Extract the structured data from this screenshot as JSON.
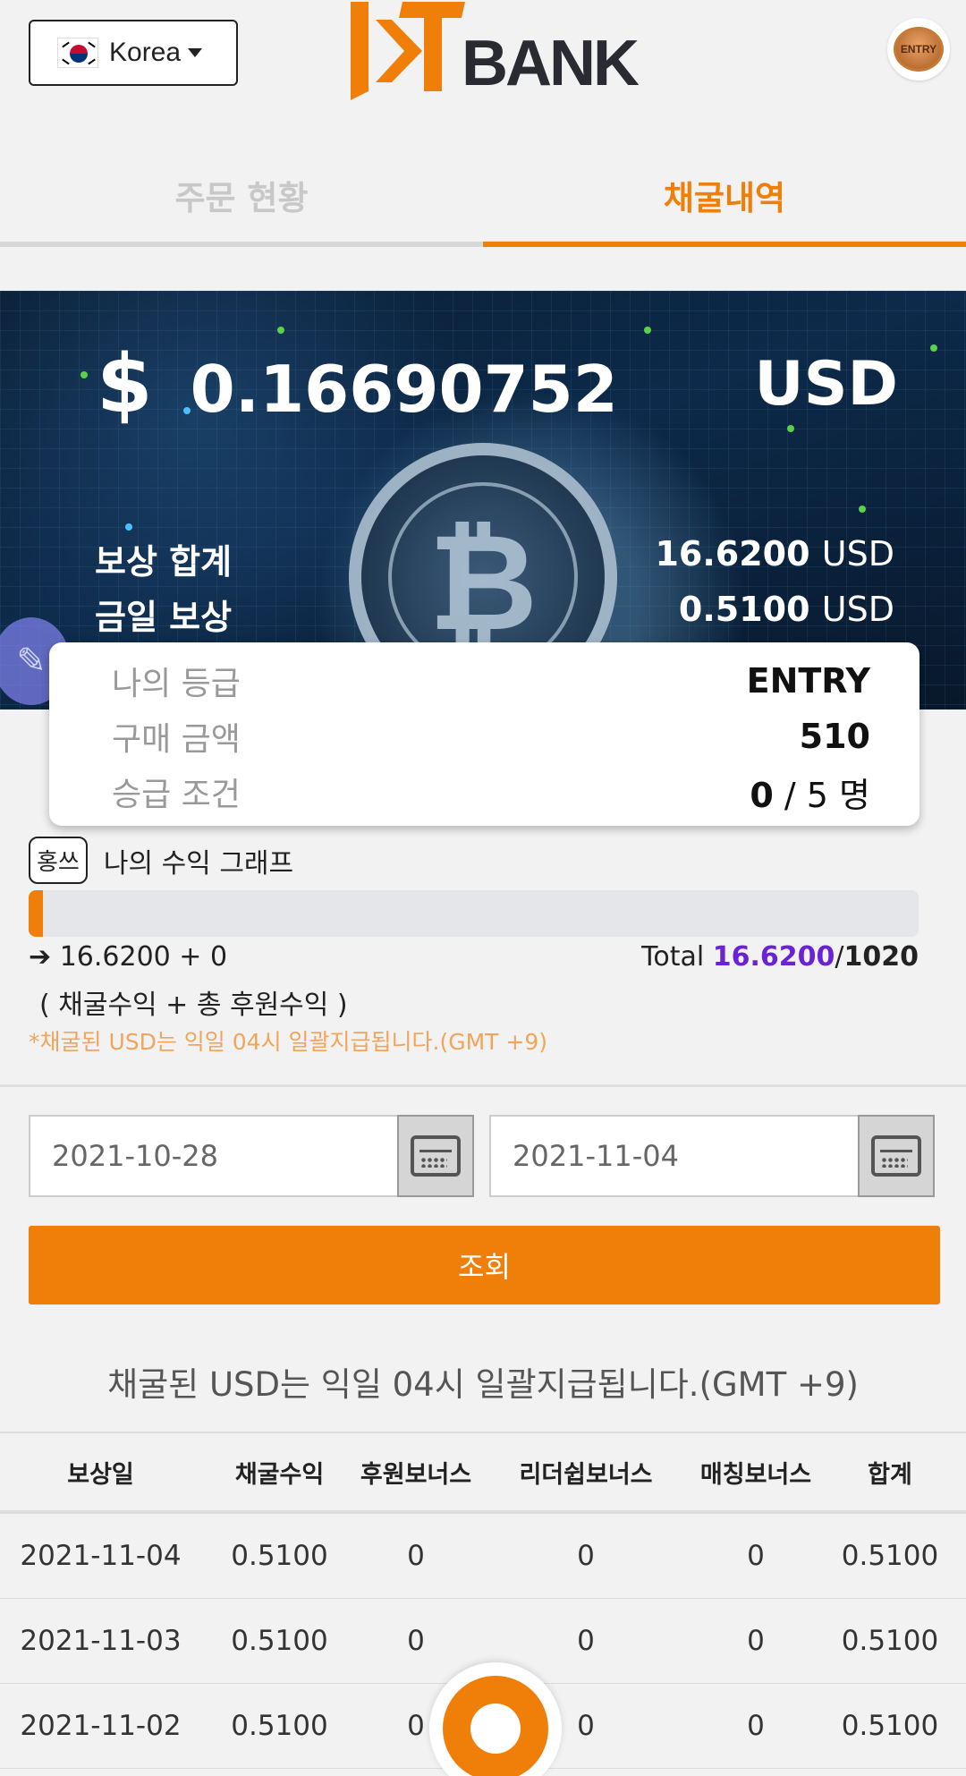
{
  "header": {
    "country_label": "Korea",
    "logo_text": "BANK",
    "logo_sub": "...",
    "badge_label": "ENTRY"
  },
  "tabs": [
    {
      "label": "주문 현황",
      "active": false
    },
    {
      "label": "채굴내역",
      "active": true
    }
  ],
  "banner": {
    "currency_symbol": "$",
    "amount": "0.16690752",
    "currency": "USD",
    "rows": [
      {
        "label": "보상 합계",
        "value": "16.6200",
        "unit": "USD"
      },
      {
        "label": "금일 보상",
        "value": "0.5100",
        "unit": "USD"
      }
    ]
  },
  "grade": {
    "rows": [
      {
        "label": "나의 등급",
        "value": "ENTRY"
      },
      {
        "label": "구매 금액",
        "value": "510"
      }
    ],
    "promotion": {
      "label": "승급 조건",
      "current": "0",
      "sep": " / ",
      "target": "5 명"
    }
  },
  "graph": {
    "tag": "홍쓰",
    "title": "나의 수익 그래프",
    "progress_percent": 1.6,
    "formula": "16.6200 + 0",
    "total_label": "Total ",
    "total_value": "16.6200",
    "total_sep": "/",
    "total_target": "1020",
    "formula_desc": "( 채굴수익 + 총 후원수익 )",
    "note": "*채굴된 USD는 익일 04시 일괄지급됩니다.(GMT +9)"
  },
  "filter": {
    "start_date": "2021-10-28",
    "end_date": "2021-11-04",
    "search_label": "조회"
  },
  "notice": "채굴된 USD는 익일 04시 일괄지급됩니다.(GMT +9)",
  "table": {
    "headers": [
      "보상일",
      "채굴수익",
      "후원보너스",
      "리더쉽보너스",
      "매칭보너스",
      "합계"
    ],
    "rows": [
      [
        "2021-11-04",
        "0.5100",
        "0",
        "0",
        "0",
        "0.5100"
      ],
      [
        "2021-11-03",
        "0.5100",
        "0",
        "0",
        "0",
        "0.5100"
      ],
      [
        "2021-11-02",
        "0.5100",
        "0",
        "0",
        "0",
        "0.5100"
      ]
    ]
  },
  "colors": {
    "accent": "#f07f0a",
    "purple": "#6a22d6",
    "note": "#f0a55a"
  }
}
